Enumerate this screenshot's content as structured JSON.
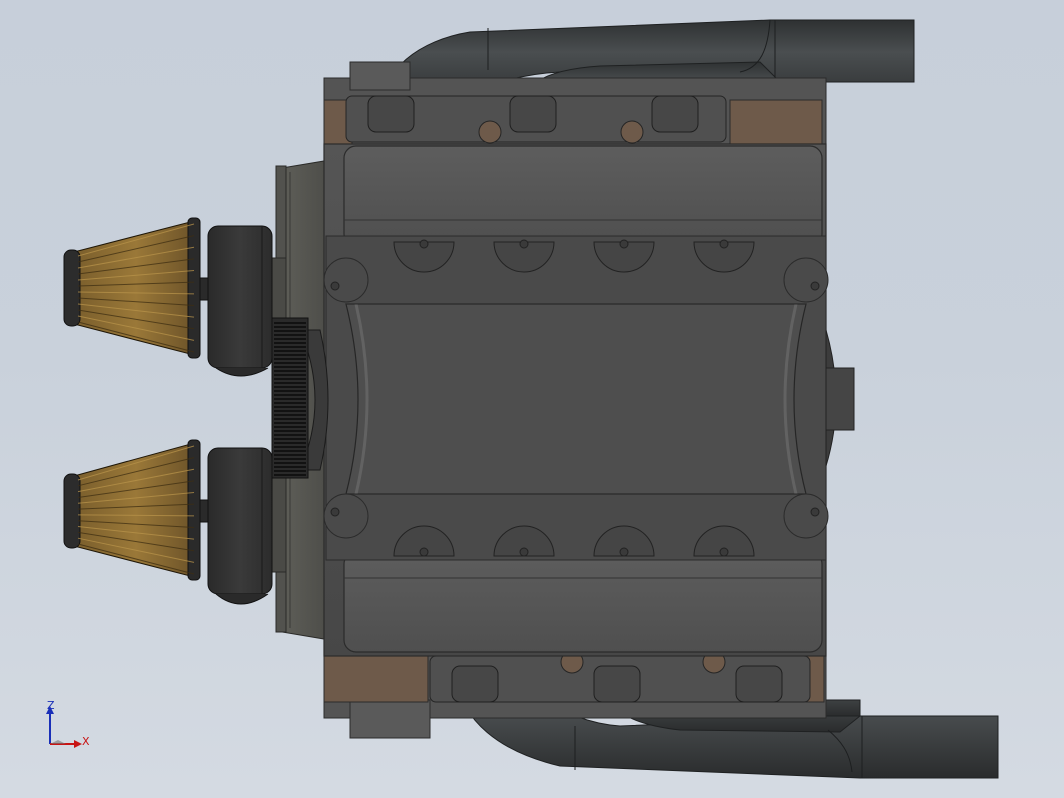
{
  "viewport": {
    "background_top": "#c7cfda",
    "background_bottom": "#d4dae2"
  },
  "model": {
    "name": "v8-engine-top-view",
    "parts": [
      "engine-block",
      "valve-cover-top",
      "valve-cover-bottom",
      "intake-manifold",
      "exhaust-headers-top",
      "exhaust-headers-bottom",
      "air-filter-cone-upper",
      "air-filter-cone-lower",
      "throttle-body-upper",
      "throttle-body-lower",
      "flywheel-ring-gear",
      "crankshaft-nose"
    ],
    "colors": {
      "block": "#4a4a4a",
      "cover": "#585858",
      "exhaust": "#3b3e3f",
      "copper": "#6e5a4a",
      "filter": "#8a6a32",
      "dark": "#262626"
    }
  },
  "triad": {
    "z_label": "Z",
    "x_label": "X",
    "z_color": "#1a2fb8",
    "x_color": "#c81414"
  }
}
